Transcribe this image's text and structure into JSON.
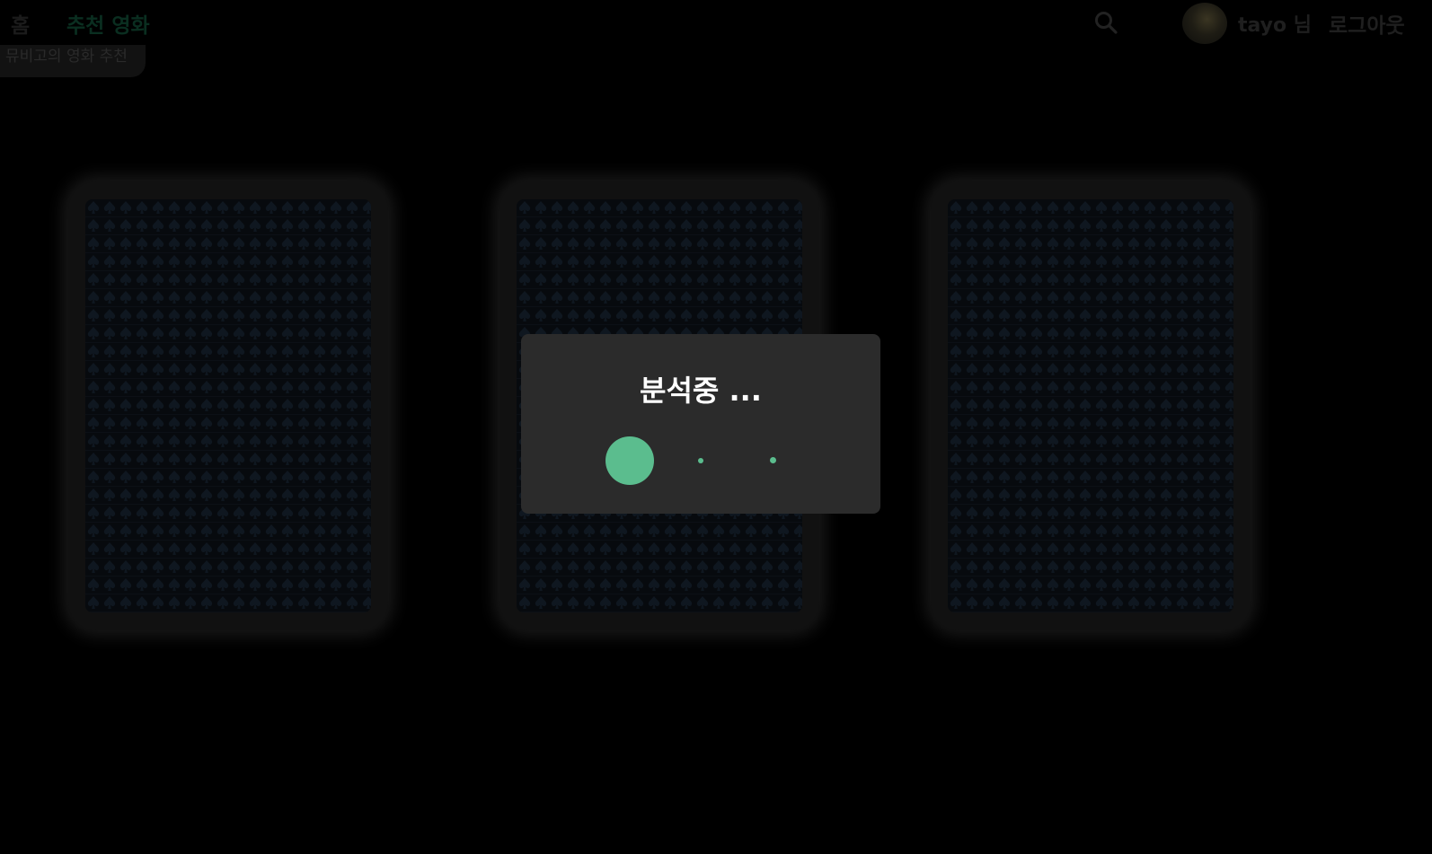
{
  "nav": {
    "home": "홈",
    "recommend": "추천 영화",
    "search_icon": "search-icon",
    "user_name": "tayo 님",
    "logout": "로그아웃"
  },
  "sub_tag": "뮤비고의 영화 추천",
  "cards": [
    {
      "pattern": "spade-pattern"
    },
    {
      "pattern": "spade-pattern"
    },
    {
      "pattern": "spade-pattern"
    }
  ],
  "loading": {
    "title": "분석중 ...",
    "dot_color": "#5bbd8e"
  },
  "colors": {
    "background": "#000000",
    "modal": "#2b2b2b",
    "accent": "#5bbd8e",
    "card": "#111111"
  }
}
